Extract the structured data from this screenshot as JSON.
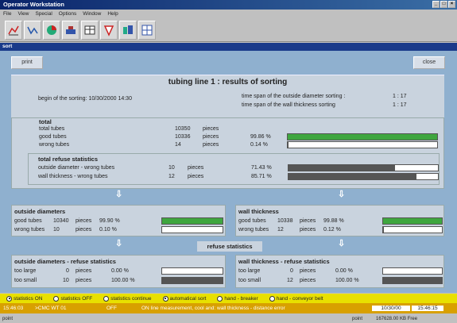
{
  "window": {
    "title": "Operator Workstation"
  },
  "menu": [
    "File",
    "View",
    "Special",
    "Options",
    "Window",
    "Help"
  ],
  "toolbar_icons": [
    "chart-icon",
    "graph-icon",
    "pie-icon",
    "machine-icon",
    "table-icon",
    "shield-icon",
    "bundle-icon",
    "schema-icon"
  ],
  "subwindow": {
    "title": "sort"
  },
  "actions": {
    "print": "print",
    "close": "close"
  },
  "header": {
    "title": "tubing line 1  : results of sorting",
    "begin_label": "begin of the sorting:",
    "begin_date": "10/30/2000",
    "begin_time": "14:30",
    "od_span_label": "time span of the outside diameter sorting :",
    "od_span": "1 : 17",
    "wall_span_label": "time span of the wall thickness sorting",
    "wall_span": "1 : 17"
  },
  "total": {
    "title": "total",
    "rows": [
      {
        "label": "total tubes",
        "value": "10350",
        "unit": "pieces",
        "pct": "",
        "pct_value": null
      },
      {
        "label": "good tubes",
        "value": "10336",
        "unit": "pieces",
        "pct": "99.86 %",
        "pct_value": 99.86
      },
      {
        "label": "wrong tubes",
        "value": "14",
        "unit": "pieces",
        "pct": "0.14 %",
        "pct_value": 0.14
      }
    ]
  },
  "refuse": {
    "title": "total refuse statistics",
    "rows": [
      {
        "label": "outside diameter - wrong tubes",
        "value": "10",
        "unit": "pieces",
        "pct": "71.43 %",
        "pct_value": 71.43
      },
      {
        "label": "wall thickness - wrong tubes",
        "value": "12",
        "unit": "pieces",
        "pct": "85.71 %",
        "pct_value": 85.71
      }
    ]
  },
  "od": {
    "title": "outside diameters",
    "rows": [
      {
        "label": "good tubes",
        "value": "10340",
        "unit": "pieces",
        "pct": "99.90 %",
        "pct_value": 99.9
      },
      {
        "label": "wrong tubes",
        "value": "10",
        "unit": "pieces",
        "pct": "0.10 %",
        "pct_value": 0.1
      }
    ]
  },
  "wall": {
    "title": "wall thickness",
    "rows": [
      {
        "label": "good tubes",
        "value": "10338",
        "unit": "pieces",
        "pct": "99.88 %",
        "pct_value": 99.88
      },
      {
        "label": "wrong tubes",
        "value": "12",
        "unit": "pieces",
        "pct": "0.12 %",
        "pct_value": 0.12
      }
    ]
  },
  "refuse_stats_label": "refuse statistics",
  "od_refuse": {
    "title": "outside diameters - refuse statistics",
    "rows": [
      {
        "label": "too large",
        "value": "0",
        "unit": "pieces",
        "pct": "0.00 %",
        "pct_value": 0
      },
      {
        "label": "too small",
        "value": "10",
        "unit": "pieces",
        "pct": "100.00 %",
        "pct_value": 100
      }
    ]
  },
  "wall_refuse": {
    "title": "wall thickness - refuse statistics",
    "rows": [
      {
        "label": "too large",
        "value": "0",
        "unit": "pieces",
        "pct": "0.00 %",
        "pct_value": 0
      },
      {
        "label": "too small",
        "value": "12",
        "unit": "pieces",
        "pct": "100.00 %",
        "pct_value": 100
      }
    ]
  },
  "options": [
    {
      "label": "statistics ON",
      "selected": true
    },
    {
      "label": "statistics OFF",
      "selected": false
    },
    {
      "label": "statistics continue",
      "selected": false
    },
    {
      "label": "automatical sort",
      "selected": true
    },
    {
      "label": "hand - breaker",
      "selected": false
    },
    {
      "label": "hand - conveyor belt",
      "selected": false
    }
  ],
  "message": {
    "time": "15:46:03",
    "source": ">CMC WT 01",
    "state": "OFF",
    "text": "ON line measurement, cool and: wall thickness - distance error",
    "date": "10/30/00",
    "clock": "15:46:15"
  },
  "footer": {
    "left": "point",
    "mid": "point",
    "free": "167628.00 KB Free"
  },
  "colors": {
    "good": "#3fa63f",
    "bad": "#555555",
    "accent": "#1a3a8a"
  }
}
